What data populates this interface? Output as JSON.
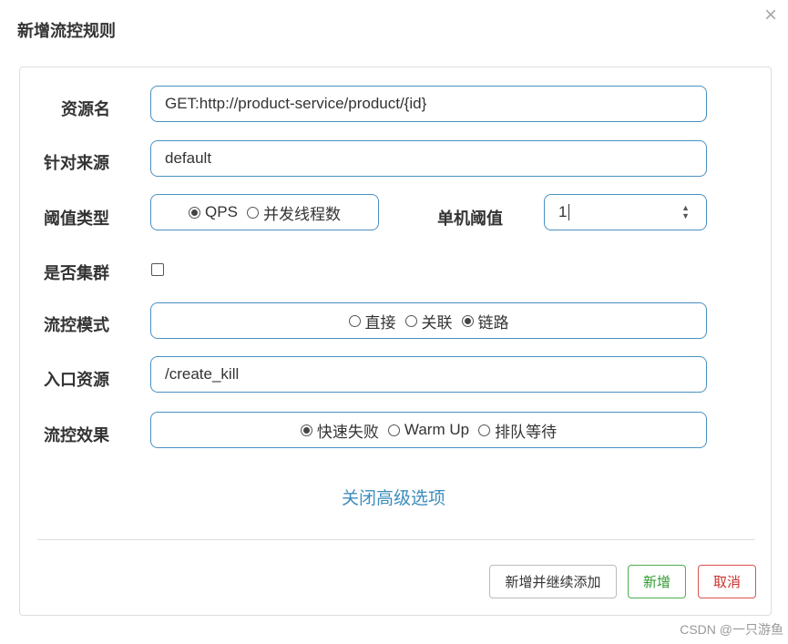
{
  "dialog": {
    "title": "新增流控规则",
    "close_symbol": "×"
  },
  "form": {
    "resource_name": {
      "label": "资源名",
      "value": "GET:http://product-service/product/{id}"
    },
    "limit_app": {
      "label": "针对来源",
      "value": "default"
    },
    "threshold_type": {
      "label": "阈值类型",
      "options": [
        {
          "label": "QPS",
          "checked": true
        },
        {
          "label": "并发线程数",
          "checked": false
        }
      ]
    },
    "single_threshold": {
      "label": "单机阈值",
      "value": "1"
    },
    "cluster_mode": {
      "label": "是否集群",
      "checked": false
    },
    "control_mode": {
      "label": "流控模式",
      "options": [
        {
          "label": "直接",
          "checked": false
        },
        {
          "label": "关联",
          "checked": false
        },
        {
          "label": "链路",
          "checked": true
        }
      ]
    },
    "entry_resource": {
      "label": "入口资源",
      "value": "/create_kill"
    },
    "control_effect": {
      "label": "流控效果",
      "options": [
        {
          "label": "快速失败",
          "checked": true
        },
        {
          "label": "Warm Up",
          "checked": false
        },
        {
          "label": "排队等待",
          "checked": false
        }
      ]
    },
    "advanced_link": "关闭高级选项"
  },
  "footer": {
    "add_continue_label": "新增并继续添加",
    "add_label": "新增",
    "cancel_label": "取消"
  },
  "watermark": "CSDN @一只游鱼",
  "colors": {
    "field_border": "#4a90c2",
    "link": "#3c8dbc",
    "success": "#4cae4c",
    "danger": "#d9534f"
  }
}
